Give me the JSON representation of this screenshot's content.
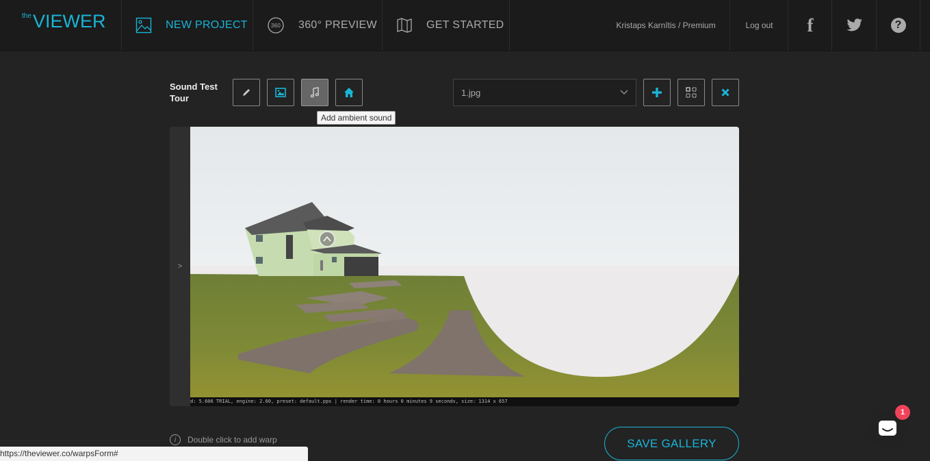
{
  "brand": {
    "small": "the",
    "name": "VIEWER"
  },
  "nav": {
    "new_project": "NEW PROJECT",
    "preview": "360° PREVIEW",
    "get_started": "GET STARTED"
  },
  "user": {
    "label": "Kristaps Karnītis / Premium",
    "logout": "Log out"
  },
  "social": {
    "facebook": "f",
    "help": "?"
  },
  "tour": {
    "title_line1": "Sound Test",
    "title_line2": "Tour"
  },
  "tools": {
    "tooltip": "Add ambient sound"
  },
  "scene_select": {
    "value": "1.jpg"
  },
  "viewer": {
    "toggle": ">",
    "render_info": "d: 5.606 TRIAL, engine: 2.60, preset: default.pps | render time: 0 hours 0 minutes 9 seconds, size: 1314 x 657"
  },
  "hint": {
    "text": "Double click to add warp",
    "icon_glyph": "i"
  },
  "save_button": "SAVE GALLERY",
  "status_url": "https://theviewer.co/warpsForm#",
  "chat": {
    "badge_count": "1"
  },
  "colors": {
    "accent": "#19b5d6",
    "badge": "#f0435a",
    "background": "#232323",
    "topbar": "#1b1b1b"
  }
}
